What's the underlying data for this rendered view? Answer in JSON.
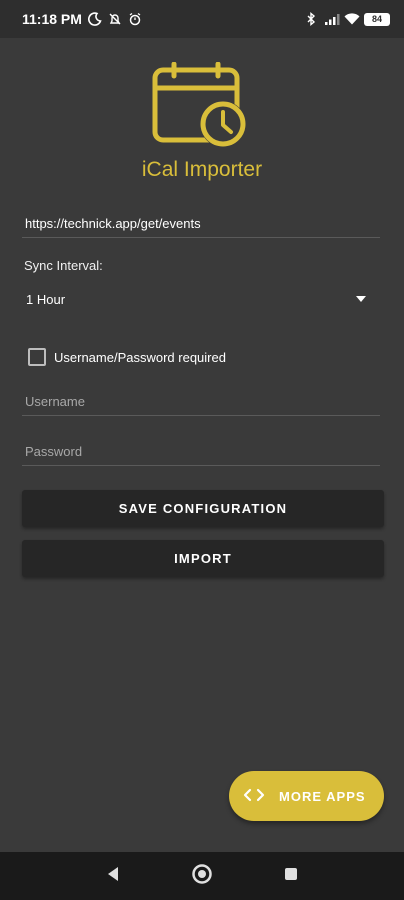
{
  "status_bar": {
    "time": "11:18 PM",
    "battery": "84",
    "icons_left": [
      "moon-icon",
      "alarm-off-icon",
      "alarm-icon"
    ],
    "icons_right": [
      "bluetooth-icon",
      "signal-icon",
      "wifi-icon",
      "battery-icon"
    ]
  },
  "app": {
    "title": "iCal Importer",
    "logo_icon": "calendar-clock-icon",
    "accent_color": "#d9be3a"
  },
  "form": {
    "url_value": "https://technick.app/get/events",
    "sync_label": "Sync Interval:",
    "sync_value": "1 Hour",
    "auth_checkbox_label": "Username/Password required",
    "auth_checked": false,
    "username_placeholder": "Username",
    "password_placeholder": "Password"
  },
  "buttons": {
    "save": "SAVE CONFIGURATION",
    "import": "IMPORT"
  },
  "fab": {
    "label": "MORE APPS",
    "icon": "code-icon"
  },
  "nav_bar": {
    "icons": [
      "back-icon",
      "home-icon",
      "recents-icon"
    ]
  }
}
